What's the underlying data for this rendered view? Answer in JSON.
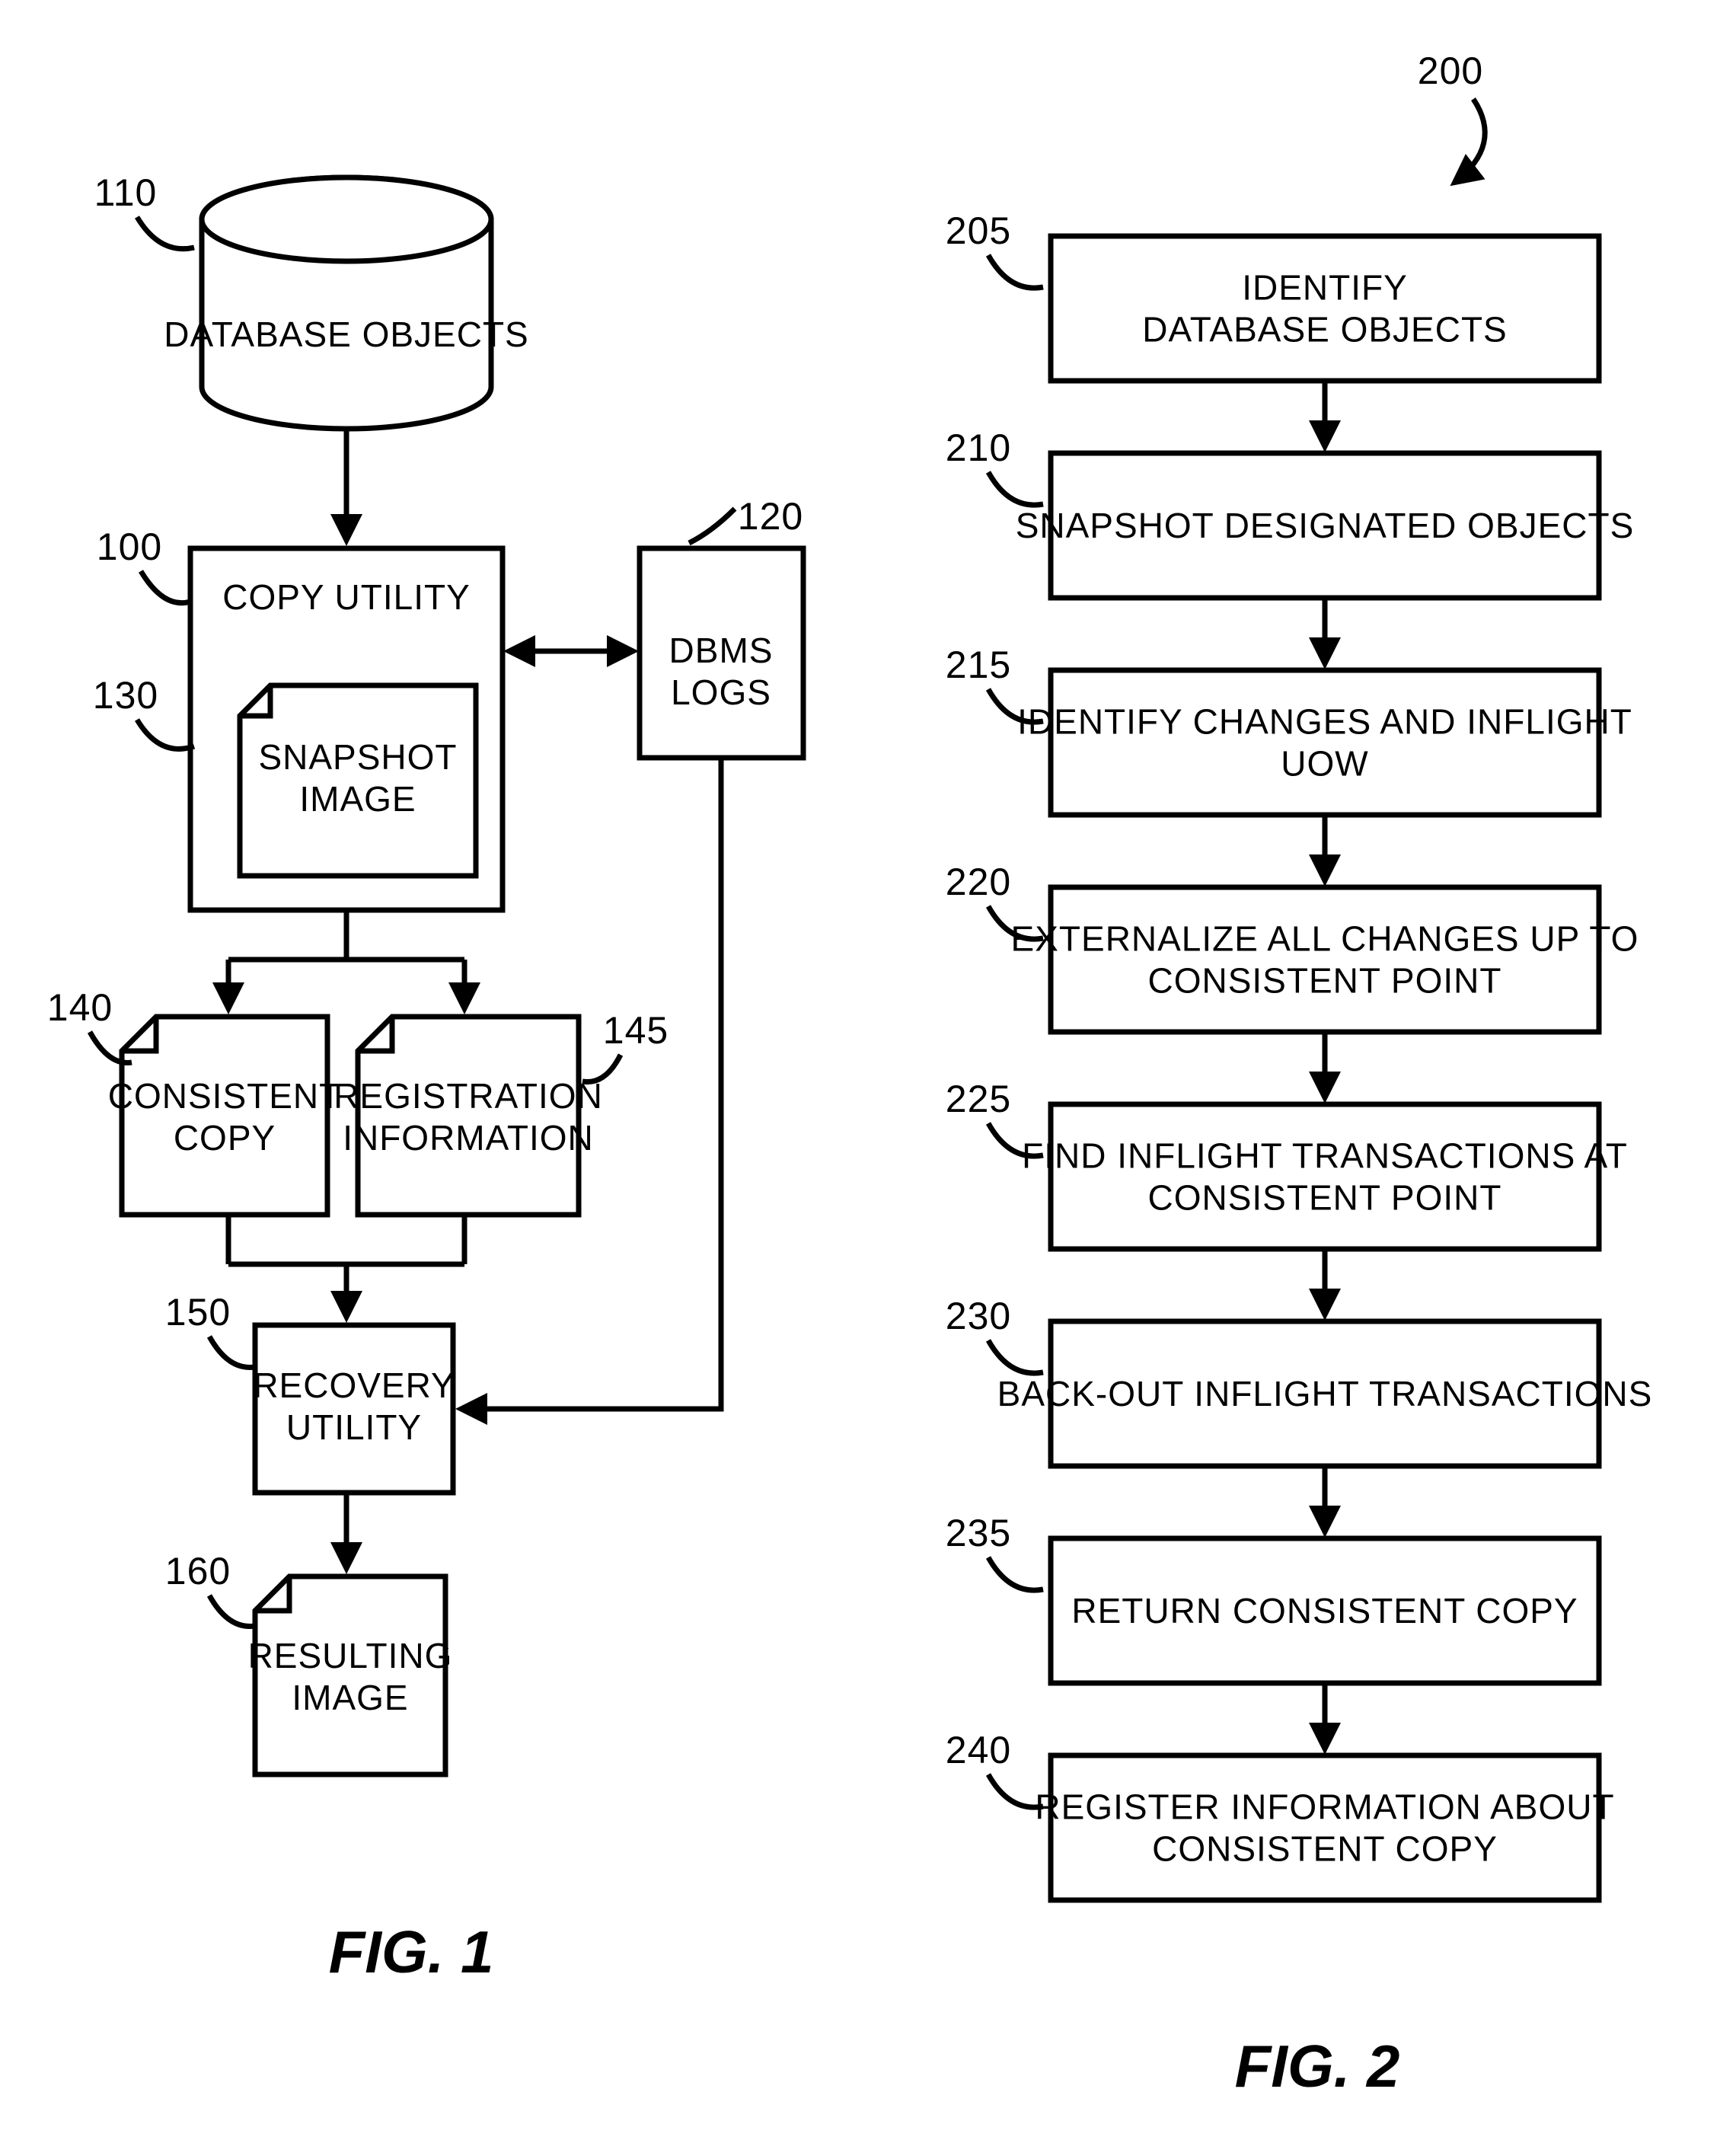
{
  "fig1": {
    "caption": "FIG. 1",
    "nodes": {
      "db": {
        "ref": "110",
        "text": [
          "DATABASE OBJECTS"
        ]
      },
      "copy": {
        "ref": "100",
        "text": [
          "COPY UTILITY"
        ]
      },
      "snapshot": {
        "ref": "130",
        "text": [
          "SNAPSHOT",
          "IMAGE"
        ]
      },
      "logs": {
        "ref": "120",
        "text": [
          "DBMS",
          "LOGS"
        ]
      },
      "ccopy": {
        "ref": "140",
        "text": [
          "CONSISTENT",
          "COPY"
        ]
      },
      "reginfo": {
        "ref": "145",
        "text": [
          "REGISTRATION",
          "INFORMATION"
        ]
      },
      "recovery": {
        "ref": "150",
        "text": [
          "RECOVERY",
          "UTILITY"
        ]
      },
      "result": {
        "ref": "160",
        "text": [
          "RESULTING",
          "IMAGE"
        ]
      }
    }
  },
  "fig2": {
    "caption": "FIG. 2",
    "topref": "200",
    "steps": [
      {
        "ref": "205",
        "text": [
          "IDENTIFY",
          "DATABASE OBJECTS"
        ]
      },
      {
        "ref": "210",
        "text": [
          "SNAPSHOT DESIGNATED OBJECTS"
        ]
      },
      {
        "ref": "215",
        "text": [
          "IDENTIFY CHANGES AND INFLIGHT",
          "UOW"
        ]
      },
      {
        "ref": "220",
        "text": [
          "EXTERNALIZE ALL CHANGES UP TO",
          "CONSISTENT POINT"
        ]
      },
      {
        "ref": "225",
        "text": [
          "FIND INFLIGHT TRANSACTIONS AT",
          "CONSISTENT POINT"
        ]
      },
      {
        "ref": "230",
        "text": [
          "BACK-OUT INFLIGHT TRANSACTIONS"
        ]
      },
      {
        "ref": "235",
        "text": [
          "RETURN CONSISTENT COPY"
        ]
      },
      {
        "ref": "240",
        "text": [
          "REGISTER INFORMATION ABOUT",
          "CONSISTENT COPY"
        ]
      }
    ]
  }
}
